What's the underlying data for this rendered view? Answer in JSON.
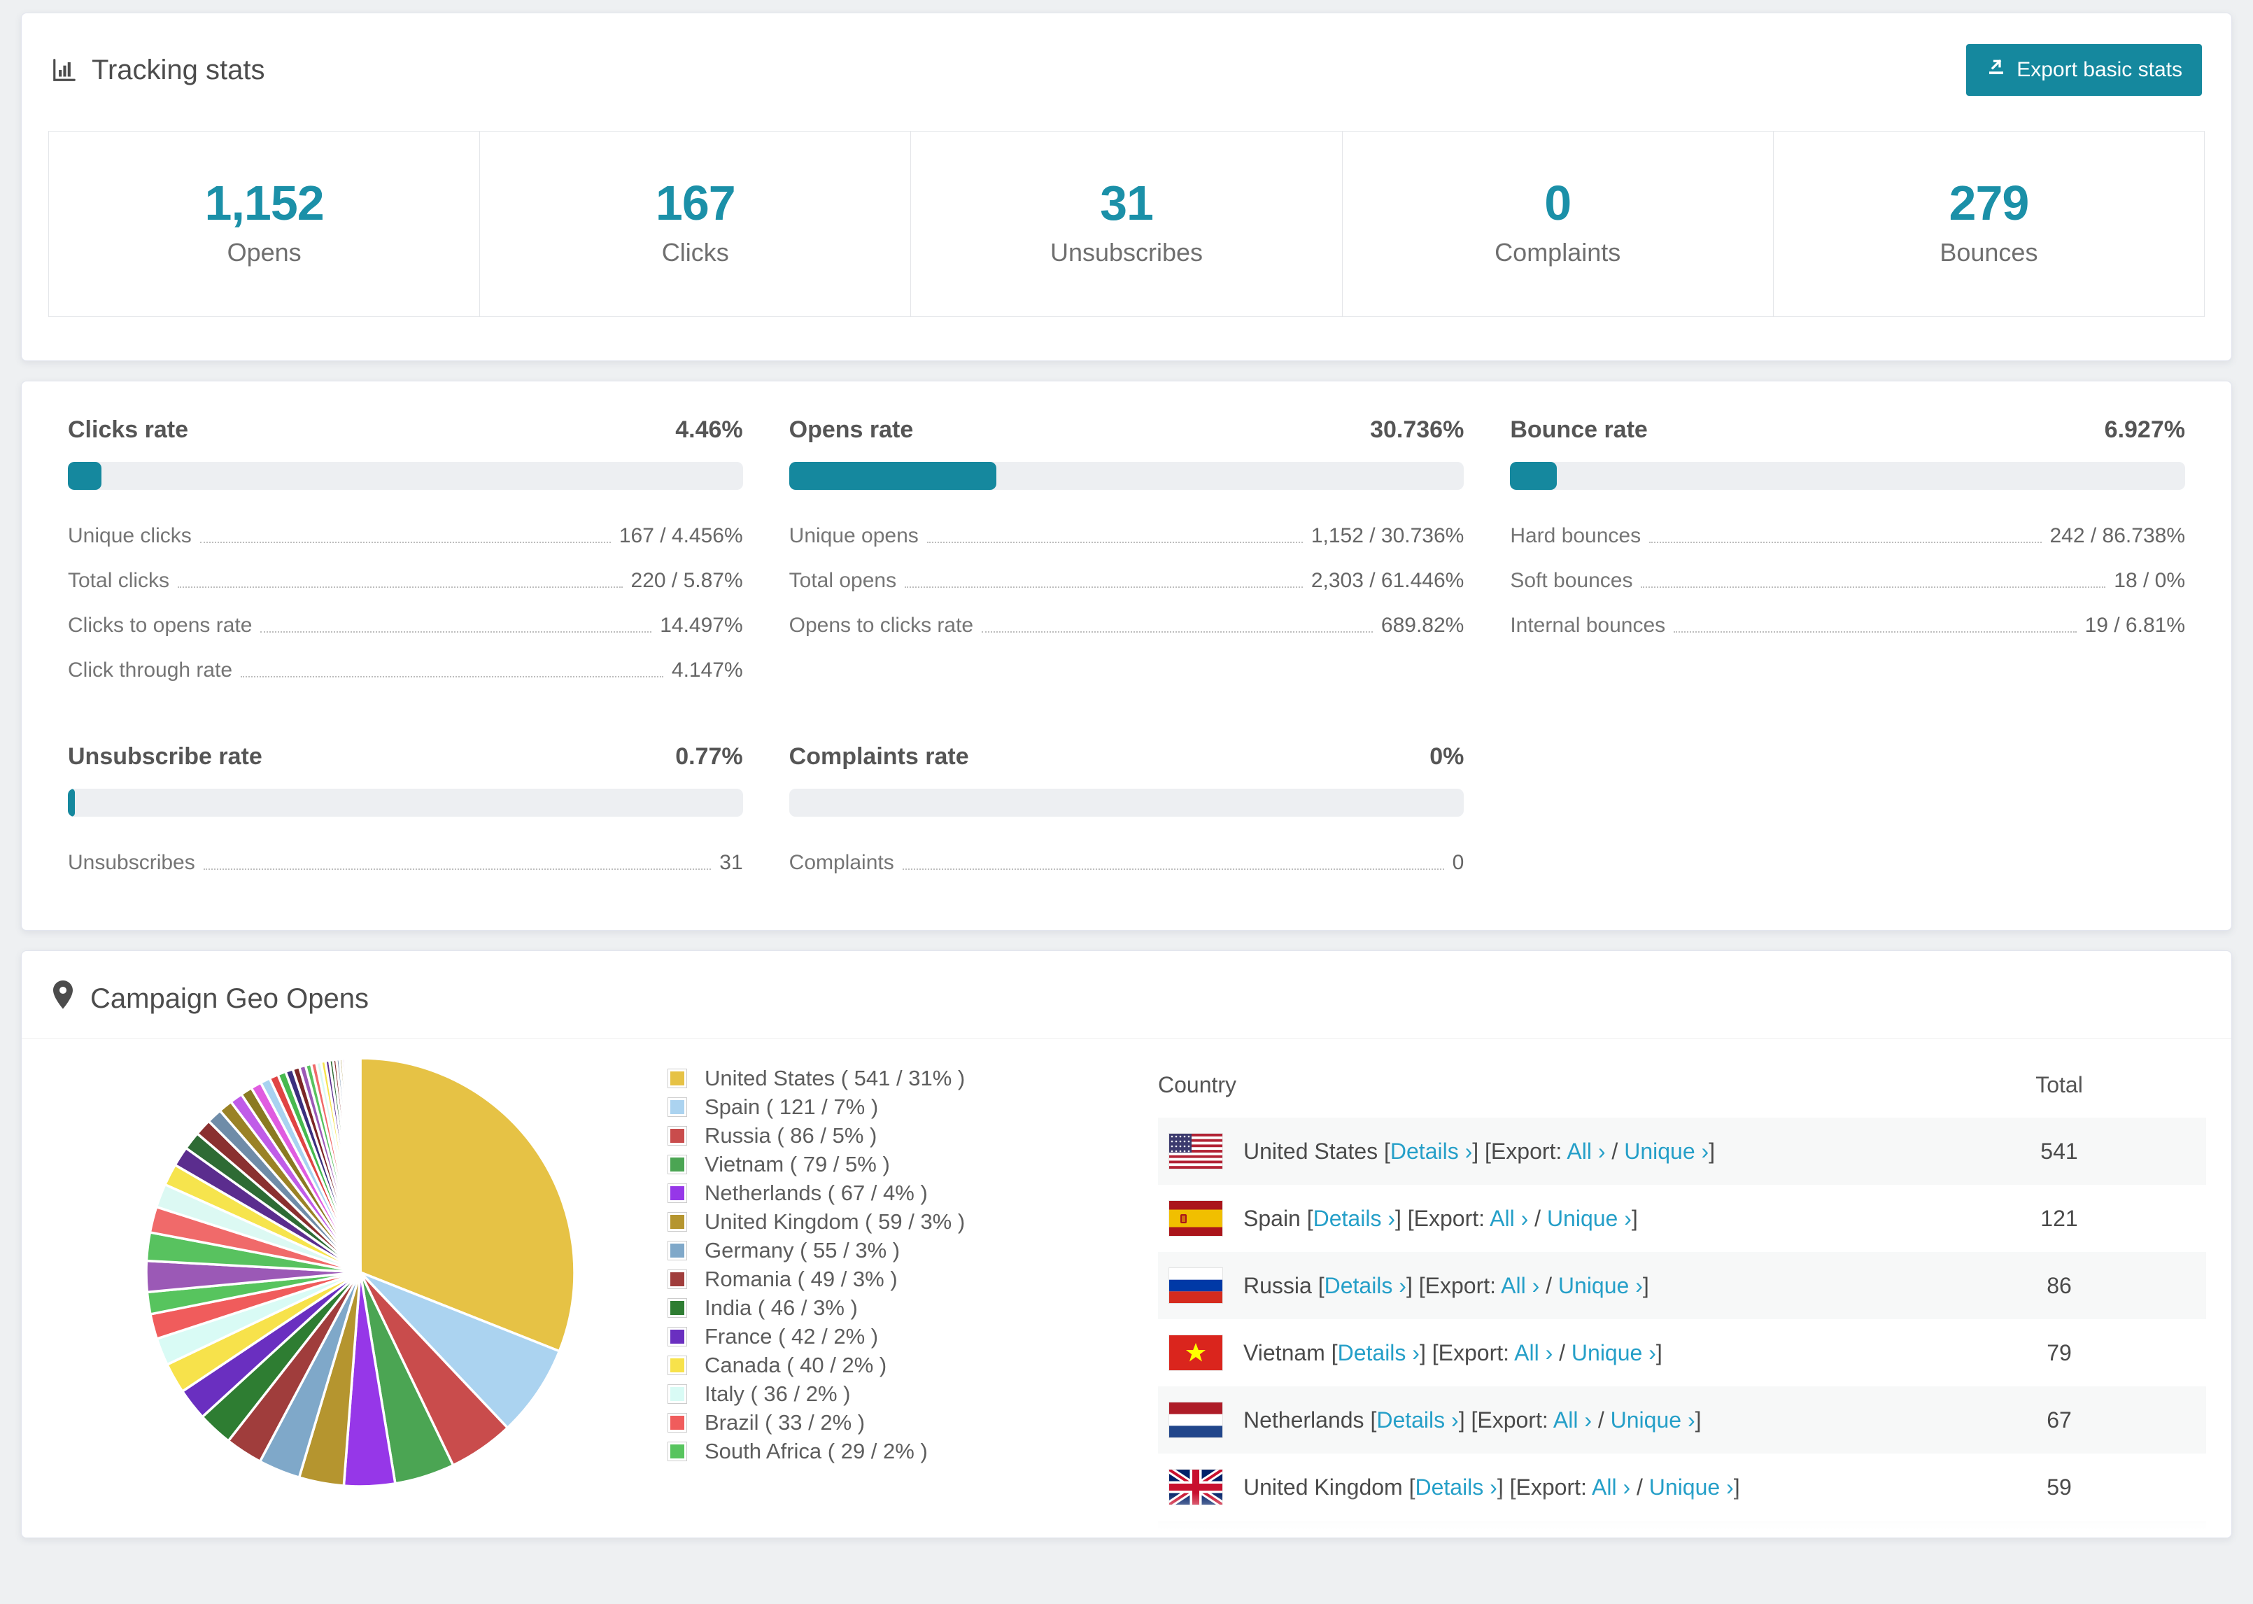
{
  "accent": "#15889e",
  "link_color": "#259fc8",
  "tracking": {
    "title": "Tracking stats",
    "title_icon": "bar-chart-icon",
    "export_label": "Export basic stats",
    "export_icon": "export-icon",
    "stats": [
      {
        "value": "1,152",
        "label": "Opens"
      },
      {
        "value": "167",
        "label": "Clicks"
      },
      {
        "value": "31",
        "label": "Unsubscribes"
      },
      {
        "value": "0",
        "label": "Complaints"
      },
      {
        "value": "279",
        "label": "Bounces"
      }
    ]
  },
  "rates": {
    "panels": [
      {
        "title": "Clicks rate",
        "value": "4.46%",
        "bar_pct": 4.46,
        "rows": [
          {
            "label": "Unique clicks",
            "value": "167 / 4.456%"
          },
          {
            "label": "Total clicks",
            "value": "220 / 5.87%"
          },
          {
            "label": "Clicks to opens rate",
            "value": "14.497%"
          },
          {
            "label": "Click through rate",
            "value": "4.147%"
          }
        ]
      },
      {
        "title": "Opens rate",
        "value": "30.736%",
        "bar_pct": 30.736,
        "rows": [
          {
            "label": "Unique opens",
            "value": "1,152 / 30.736%"
          },
          {
            "label": "Total opens",
            "value": "2,303 / 61.446%"
          },
          {
            "label": "Opens to clicks rate",
            "value": "689.82%"
          }
        ]
      },
      {
        "title": "Bounce rate",
        "value": "6.927%",
        "bar_pct": 6.927,
        "rows": [
          {
            "label": "Hard bounces",
            "value": "242 / 86.738%"
          },
          {
            "label": "Soft bounces",
            "value": "18 / 0%"
          },
          {
            "label": "Internal bounces",
            "value": "19 / 6.81%"
          }
        ]
      },
      {
        "title": "Unsubscribe rate",
        "value": "0.77%",
        "bar_pct": 0.77,
        "rows": [
          {
            "label": "Unsubscribes",
            "value": "31"
          }
        ]
      },
      {
        "title": "Complaints rate",
        "value": "0%",
        "bar_pct": 0,
        "rows": [
          {
            "label": "Complaints",
            "value": "0"
          }
        ]
      }
    ]
  },
  "geo": {
    "title": "Campaign Geo Opens",
    "title_icon": "map-pin-icon",
    "columns": {
      "country": "Country",
      "total": "Total"
    },
    "link_labels": {
      "details": "Details ›",
      "export_prefix": "Export:",
      "all": "All ›",
      "separator": "/",
      "unique": "Unique ›"
    },
    "table_rows": [
      {
        "flag": "us",
        "country": "United States",
        "total": "541"
      },
      {
        "flag": "es",
        "country": "Spain",
        "total": "121"
      },
      {
        "flag": "ru",
        "country": "Russia",
        "total": "86"
      },
      {
        "flag": "vn",
        "country": "Vietnam",
        "total": "79"
      },
      {
        "flag": "nl",
        "country": "Netherlands",
        "total": "67"
      },
      {
        "flag": "gb",
        "country": "United Kingdom",
        "total": "59"
      },
      {
        "flag": "de",
        "country": "",
        "total": "",
        "clipped": true
      }
    ]
  },
  "chart_data": {
    "type": "pie",
    "title": "Campaign Geo Opens",
    "legend_position": "right",
    "start_angle_deg": -90,
    "direction": "clockwise",
    "series": [
      {
        "label": "United States",
        "value": 541,
        "pct": 31,
        "color": "#e6c245"
      },
      {
        "label": "Spain",
        "value": 121,
        "pct": 7,
        "color": "#abd3f0"
      },
      {
        "label": "Russia",
        "value": 86,
        "pct": 5,
        "color": "#c94c4c"
      },
      {
        "label": "Vietnam",
        "value": 79,
        "pct": 5,
        "color": "#4ba553"
      },
      {
        "label": "Netherlands",
        "value": 67,
        "pct": 4,
        "color": "#9637e8"
      },
      {
        "label": "United Kingdom",
        "value": 59,
        "pct": 3,
        "color": "#b5952f"
      },
      {
        "label": "Germany",
        "value": 55,
        "pct": 3,
        "color": "#7fa8c9"
      },
      {
        "label": "Romania",
        "value": 49,
        "pct": 3,
        "color": "#a03d3c"
      },
      {
        "label": "India",
        "value": 46,
        "pct": 3,
        "color": "#2e7d32"
      },
      {
        "label": "France",
        "value": 42,
        "pct": 2,
        "color": "#6a2fc0"
      },
      {
        "label": "Canada",
        "value": 40,
        "pct": 2,
        "color": "#f7e24b"
      },
      {
        "label": "Italy",
        "value": 36,
        "pct": 2,
        "color": "#d9fbf5"
      },
      {
        "label": "Brazil",
        "value": 33,
        "pct": 2,
        "color": "#f05c5c"
      },
      {
        "label": "South Africa",
        "value": 29,
        "pct": 2,
        "color": "#57c45e"
      }
    ],
    "others": {
      "note": "many small unlabeled slices completing the circle",
      "approx_value_total": 462,
      "visible_slice_count": 38
    }
  }
}
